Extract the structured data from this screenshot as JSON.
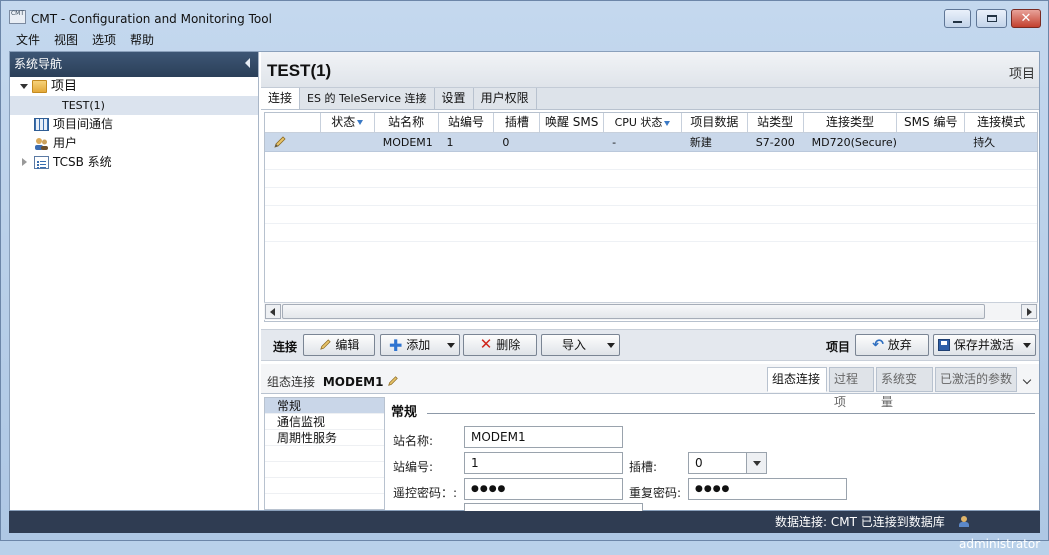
{
  "window": {
    "app_icon_text": "CMT",
    "title": "CMT - Configuration and Monitoring Tool"
  },
  "menu": [
    "文件",
    "视图",
    "选项",
    "帮助"
  ],
  "nav": {
    "header": "系统导航",
    "tree": [
      {
        "label": "项目",
        "icon": "folder-icon"
      },
      {
        "label": "TEST(1)",
        "selected": true
      },
      {
        "label": "项目间通信",
        "icon": "grid-icon"
      },
      {
        "label": "用户",
        "icon": "users-icon"
      },
      {
        "label": "TCSB 系统",
        "icon": "list-icon"
      }
    ]
  },
  "main": {
    "title": "TEST(1)",
    "right_label": "项目",
    "tabs": [
      "连接",
      "ES 的 TeleService 连接",
      "设置",
      "用户权限"
    ],
    "grid": {
      "columns": [
        "",
        "状态",
        "站名称",
        "站编号",
        "插槽",
        "唤醒 SMS",
        "CPU 状态",
        "项目数据",
        "站类型",
        "连接类型",
        "SMS 编号",
        "连接模式"
      ],
      "row": [
        "",
        "",
        "MODEM1",
        "1",
        "0",
        "",
        "-",
        "新建",
        "S7-200",
        "MD720(Secure)",
        "",
        "持久"
      ]
    },
    "toolbar": {
      "left_label": "连接",
      "edit": "编辑",
      "add": "添加",
      "delete": "删除",
      "import": "导入",
      "right_label": "项目",
      "discard": "放弃",
      "save_activate": "保存并激活"
    },
    "detail": {
      "prefix": "组态连接",
      "name": "MODEM1",
      "tabs": [
        "组态连接",
        "过程项",
        "系统变量",
        "已激活的参数"
      ],
      "subnav": [
        "常规",
        "通信监视",
        "周期性服务"
      ],
      "section": "常规",
      "fields": {
        "station_name_label": "站名称:",
        "station_name": "MODEM1",
        "station_no_label": "站编号:",
        "station_no": "1",
        "slot_label": "插槽:",
        "slot": "0",
        "remote_pw_label": "遥控密码：:",
        "remote_pw": "●●●●",
        "repeat_pw_label": "重复密码:",
        "repeat_pw": "●●●●"
      }
    }
  },
  "status": {
    "connection": "数据连接: CMT 已连接到数据库",
    "user": "administrator"
  },
  "colors": {
    "nav_header": "#2b3f58",
    "status_bar": "#2f3c52",
    "selected_row": "#cad8ea",
    "close_button": "#c3402e"
  }
}
